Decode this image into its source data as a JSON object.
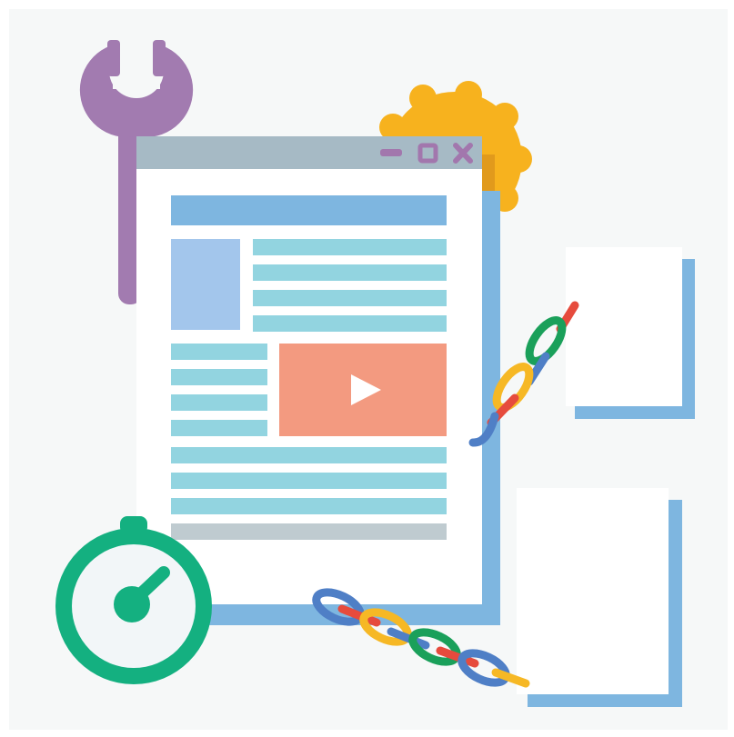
{
  "illustration": {
    "window_controls": {
      "minimize_icon": "minimize-icon",
      "maximize_icon": "maximize-icon",
      "close_icon": "close-icon"
    },
    "media": {
      "play_icon": "play-icon"
    },
    "icons": [
      "wrench-icon",
      "gear-icon",
      "stopwatch-icon",
      "chain-link-icon",
      "document-icon"
    ]
  },
  "colors": {
    "background": "#f6f8f8",
    "window_shadow": "#7eb6e0",
    "titlebar": "#a6bac5",
    "control": "#a277ad",
    "header_bar": "#7eb6e0",
    "image_block": "#a3c6ec",
    "text_line": "#92d4e0",
    "video_block": "#f39a80",
    "footer_bar": "#bfcbd0",
    "wrench": "#a27bb0",
    "gear": "#f7b21e",
    "gear_shade": "#e19a1c",
    "stopwatch": "#14b080",
    "stopwatch_face": "#f2f6f8",
    "chain_blue": "#4f7fc6",
    "chain_red": "#e64b3d",
    "chain_yellow": "#f6b825",
    "chain_green": "#1aa05a",
    "page_shadow": "#7eb6e0",
    "page": "#ffffff"
  }
}
